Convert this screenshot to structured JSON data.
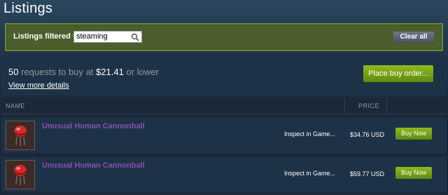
{
  "page": {
    "title": "Listings"
  },
  "filter": {
    "label": "Listings filtered to:",
    "value": "steaming",
    "search_icon": "search-icon",
    "clear_label": "Clear all"
  },
  "buy_orders": {
    "count": "50",
    "requests_text": " requests to buy at ",
    "price": "$21.41",
    "suffix": " or lower",
    "view_more": "View more details",
    "button_label": "Place buy order..."
  },
  "table": {
    "header_name": "NAME",
    "header_price": "PRICE",
    "rows": [
      {
        "name": "Unusual Human Cannonball",
        "inspect": "Inspect in Game...",
        "price": "$34.76 USD",
        "buy_label": "Buy Now",
        "icon": "helmet-icon"
      },
      {
        "name": "Unusual Human Cannonball",
        "inspect": "Inspect in Game...",
        "price": "$59.77 USD",
        "buy_label": "Buy Now",
        "icon": "helmet-icon"
      }
    ]
  },
  "colors": {
    "unusual": "#8650ac",
    "accent_green": "#8fba1f",
    "background": "#1b2838"
  }
}
